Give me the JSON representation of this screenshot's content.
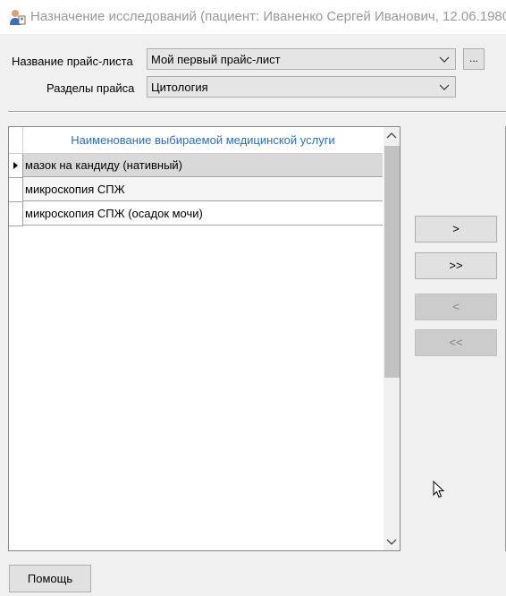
{
  "window": {
    "title": "Назначение исследований (пациент: Иваненко Сергей Иванович, 12.06.1980",
    "icon": "patient-app-icon"
  },
  "form": {
    "pricelist_label": "Название прайс-листа",
    "pricelist_value": "Мой первый прайс-лист",
    "browse_label": "...",
    "section_label": "Разделы прайса",
    "section_value": "Цитология"
  },
  "grid": {
    "column_header": "Наименование выбираемой медицинской услуги",
    "rows": [
      "мазок на кандиду (нативный)",
      "микроскопия СПЖ",
      "микроскопия СПЖ (осадок мочи)"
    ],
    "selected_index": 0
  },
  "move_buttons": {
    "add_one": ">",
    "add_all": ">>",
    "remove_one": "<",
    "remove_all": "<<"
  },
  "footer": {
    "help_label": "Помощь"
  },
  "colors": {
    "header_text": "#2a6fbe",
    "selected_row": "#d9d9d9",
    "window_bg": "#f0f0f0"
  }
}
